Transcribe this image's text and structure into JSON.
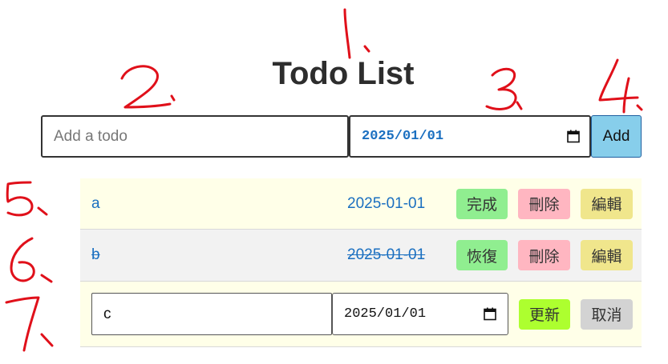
{
  "header": {
    "title": "Todo List"
  },
  "add_form": {
    "text_placeholder": "Add a todo",
    "date_value": "2025/01/01",
    "add_label": "Add"
  },
  "todos": [
    {
      "text": "a",
      "date": "2025-01-01",
      "completed": false,
      "toggle_label": "完成",
      "delete_label": "刪除",
      "edit_label": "編輯"
    },
    {
      "text": "b",
      "date": "2025-01-01",
      "completed": true,
      "toggle_label": "恢復",
      "delete_label": "刪除",
      "edit_label": "編輯"
    }
  ],
  "editing_row": {
    "text_value": "c",
    "date_value": "2025/01/01",
    "update_label": "更新",
    "cancel_label": "取消"
  },
  "annotations": [
    "1.",
    "2.",
    "3.",
    "4.",
    "5.",
    "6.",
    "7."
  ],
  "colors": {
    "annotation": "#e0101a",
    "text_link": "#1a6fc0",
    "add_button": "#87ceeb",
    "complete": "#90ee90",
    "delete": "#ffb6c1",
    "edit": "#f0e68c",
    "update": "#adff2f",
    "cancel": "#d3d3d3",
    "row_active": "#ffffe8",
    "row_done": "#f2f2f2"
  },
  "icons": {
    "date_picker": "calendar-icon"
  }
}
